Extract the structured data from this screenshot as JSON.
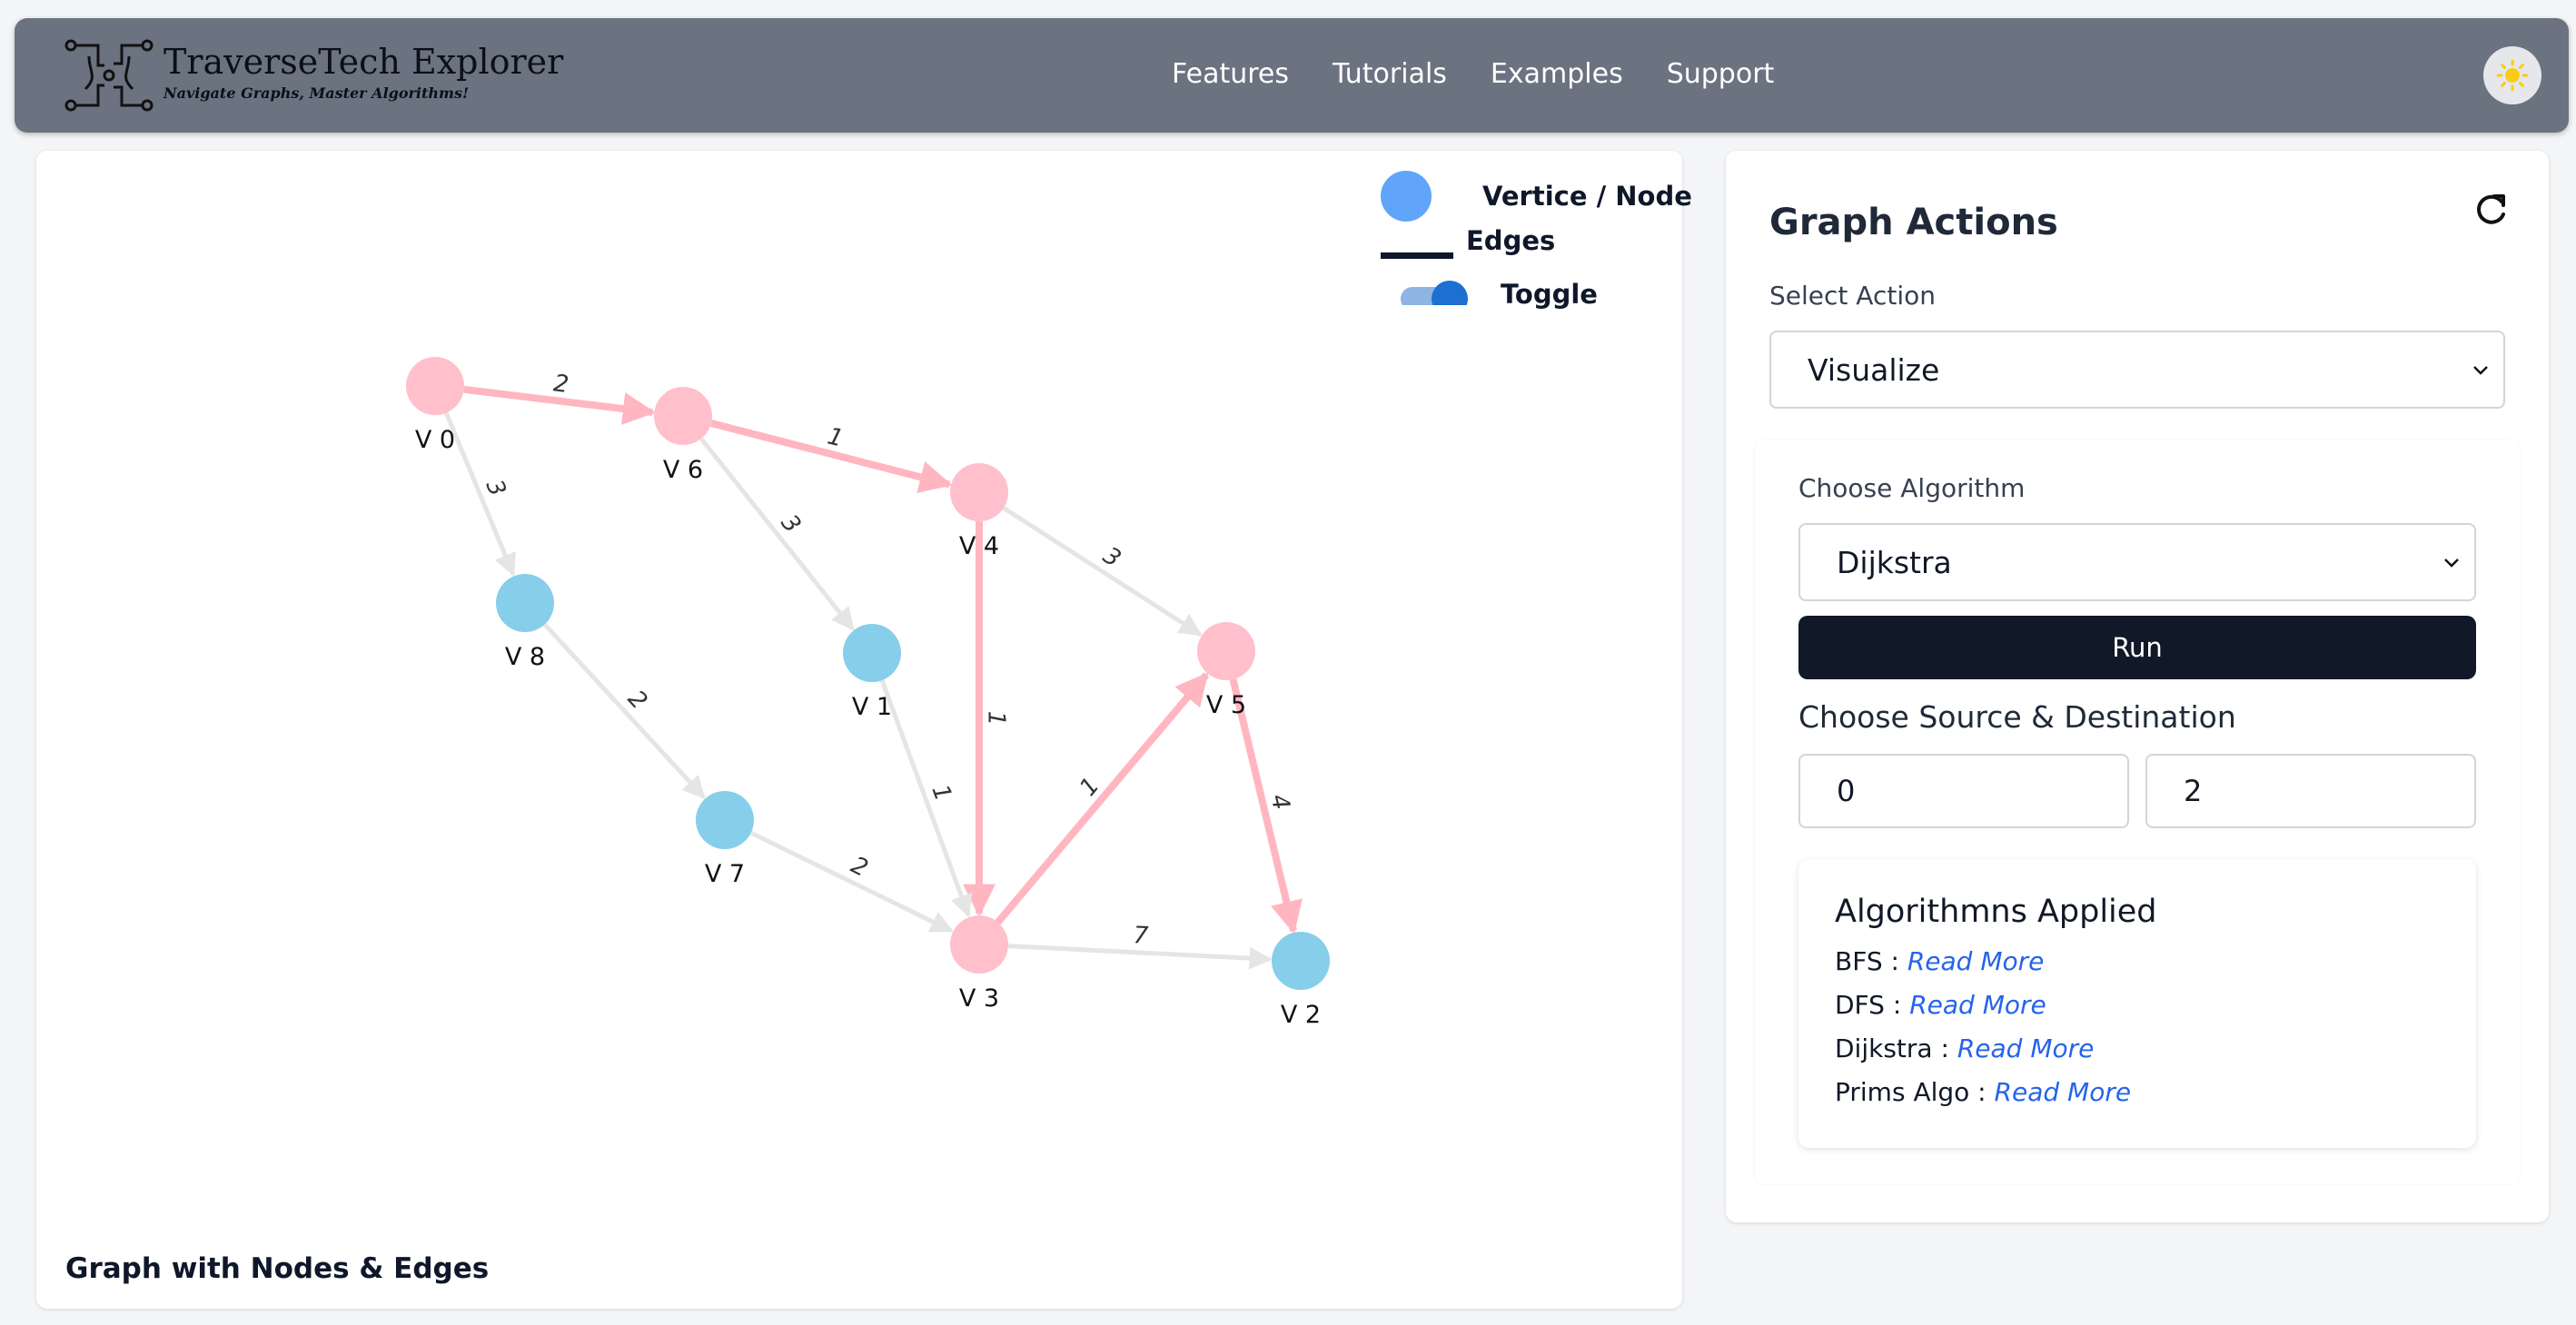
{
  "header": {
    "app_title": "TraverseTech Explorer",
    "tagline": "Navigate Graphs, Master Algorithms!",
    "nav": [
      "Features",
      "Tutorials",
      "Examples",
      "Support"
    ],
    "theme_icon": "sun-icon"
  },
  "graph": {
    "legend": {
      "node_label": "Vertice / Node",
      "edge_label": "Edges",
      "toggle_label": "Toggle",
      "toggle_on": true
    },
    "footer_title": "Graph with Nodes & Edges",
    "colors": {
      "path_node": "#ffc0cb",
      "normal_node": "#87ceeb",
      "path_edge": "#ffb6c1",
      "normal_edge": "#e5e5e5",
      "legend_node": "#60a5fa"
    },
    "nodes": [
      {
        "id": "V 0",
        "path": true
      },
      {
        "id": "V 6",
        "path": true
      },
      {
        "id": "V 4",
        "path": true
      },
      {
        "id": "V 8",
        "path": false
      },
      {
        "id": "V 1",
        "path": false
      },
      {
        "id": "V 5",
        "path": true
      },
      {
        "id": "V 7",
        "path": false
      },
      {
        "id": "V 3",
        "path": true
      },
      {
        "id": "V 2",
        "path": false
      }
    ],
    "edges": [
      {
        "from": "V 0",
        "to": "V 6",
        "weight": "2",
        "path": true
      },
      {
        "from": "V 6",
        "to": "V 4",
        "weight": "1",
        "path": true
      },
      {
        "from": "V 0",
        "to": "V 8",
        "weight": "3",
        "path": false
      },
      {
        "from": "V 6",
        "to": "V 1",
        "weight": "3",
        "path": false
      },
      {
        "from": "V 4",
        "to": "V 5",
        "weight": "3",
        "path": false
      },
      {
        "from": "V 4",
        "to": "V 3",
        "weight": "1",
        "path": true
      },
      {
        "from": "V 8",
        "to": "V 7",
        "weight": "2",
        "path": false
      },
      {
        "from": "V 1",
        "to": "V 3",
        "weight": "1",
        "path": false
      },
      {
        "from": "V 7",
        "to": "V 3",
        "weight": "2",
        "path": false
      },
      {
        "from": "V 3",
        "to": "V 5",
        "weight": "1",
        "path": true
      },
      {
        "from": "V 5",
        "to": "V 2",
        "weight": "4",
        "path": true
      },
      {
        "from": "V 3",
        "to": "V 2",
        "weight": "7",
        "path": false
      }
    ]
  },
  "actions": {
    "title": "Graph Actions",
    "refresh_icon": "refresh-icon",
    "select_action_label": "Select Action",
    "select_action_value": "Visualize",
    "choose_algorithm_label": "Choose Algorithm",
    "algorithm_value": "Dijkstra",
    "run_label": "Run",
    "source_dest_label": "Choose Source & Destination",
    "source_value": "0",
    "destination_value": "2",
    "applied": {
      "title": "Algorithmns Applied",
      "items": [
        {
          "name": "BFS :",
          "link": "Read More"
        },
        {
          "name": "DFS :",
          "link": "Read More"
        },
        {
          "name": "Dijkstra :",
          "link": "Read More"
        },
        {
          "name": "Prims Algo :",
          "link": "Read More"
        }
      ]
    }
  }
}
